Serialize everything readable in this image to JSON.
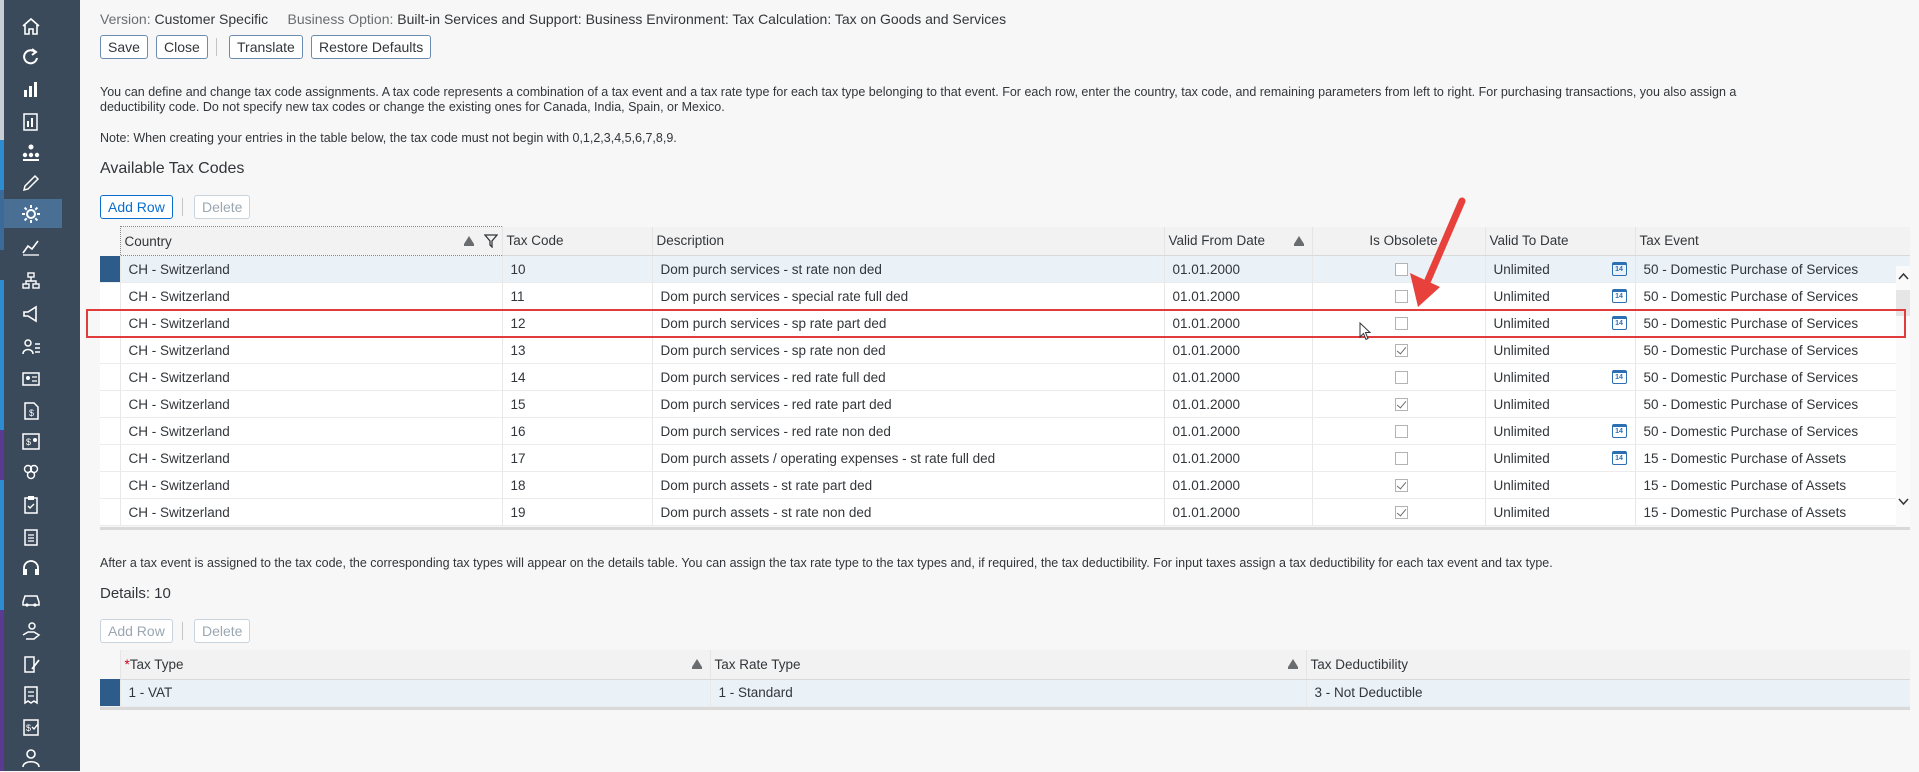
{
  "header": {
    "version_label": "Version:",
    "version_value": "Customer Specific",
    "bo_label": "Business Option:",
    "bo_value": "Built-in Services and Support: Business Environment: Tax Calculation: Tax on Goods and Services"
  },
  "toolbar": {
    "save": "Save",
    "close": "Close",
    "translate": "Translate",
    "restore": "Restore Defaults"
  },
  "intro": {
    "line1": "You can define and change tax code assignments. A tax code represents a combination of a tax event and a tax rate type for each tax type belonging to that event. For each row, enter the country, tax code, and remaining parameters from left to right. For purchasing transactions, you also assign a",
    "line2": "deductibility code. Do not specify new tax codes or change the existing ones for Canada, India, Spain, or Mexico.",
    "note": "Note: When creating your entries in the table below, the tax code must not begin with 0,1,2,3,4,5,6,7,8,9."
  },
  "tax_codes": {
    "title": "Available Tax Codes",
    "add_row": "Add Row",
    "delete": "Delete",
    "columns": [
      "Country",
      "Tax Code",
      "Description",
      "Valid From Date",
      "Is Obsolete",
      "Valid To Date",
      "Tax Event"
    ],
    "rows": [
      {
        "country": "CH - Switzerland",
        "code": "10",
        "desc": "Dom purch services - st rate non ded",
        "from": "01.01.2000",
        "obsolete": false,
        "to": "Unlimited",
        "cal": true,
        "event": "50 - Domestic Purchase of Services"
      },
      {
        "country": "CH - Switzerland",
        "code": "11",
        "desc": "Dom purch services - special rate full ded",
        "from": "01.01.2000",
        "obsolete": false,
        "to": "Unlimited",
        "cal": true,
        "event": "50 - Domestic Purchase of Services"
      },
      {
        "country": "CH - Switzerland",
        "code": "12",
        "desc": "Dom purch services - sp rate part ded",
        "from": "01.01.2000",
        "obsolete": false,
        "to": "Unlimited",
        "cal": true,
        "event": "50 - Domestic Purchase of Services"
      },
      {
        "country": "CH - Switzerland",
        "code": "13",
        "desc": "Dom purch services - sp rate non ded",
        "from": "01.01.2000",
        "obsolete": true,
        "to": "Unlimited",
        "cal": false,
        "event": "50 - Domestic Purchase of Services"
      },
      {
        "country": "CH - Switzerland",
        "code": "14",
        "desc": "Dom purch services - red rate full ded",
        "from": "01.01.2000",
        "obsolete": false,
        "to": "Unlimited",
        "cal": true,
        "event": "50 - Domestic Purchase of Services"
      },
      {
        "country": "CH - Switzerland",
        "code": "15",
        "desc": "Dom purch services - red rate part ded",
        "from": "01.01.2000",
        "obsolete": true,
        "to": "Unlimited",
        "cal": false,
        "event": "50 - Domestic Purchase of Services"
      },
      {
        "country": "CH - Switzerland",
        "code": "16",
        "desc": "Dom purch services - red rate non ded",
        "from": "01.01.2000",
        "obsolete": false,
        "to": "Unlimited",
        "cal": true,
        "event": "50 - Domestic Purchase of Services"
      },
      {
        "country": "CH - Switzerland",
        "code": "17",
        "desc": "Dom purch assets / operating expenses - st rate full ded",
        "from": "01.01.2000",
        "obsolete": false,
        "to": "Unlimited",
        "cal": true,
        "event": "15 - Domestic Purchase of Assets"
      },
      {
        "country": "CH - Switzerland",
        "code": "18",
        "desc": "Dom purch assets - st rate part ded",
        "from": "01.01.2000",
        "obsolete": true,
        "to": "Unlimited",
        "cal": false,
        "event": "15 - Domestic Purchase of Assets"
      },
      {
        "country": "CH - Switzerland",
        "code": "19",
        "desc": "Dom purch assets - st rate non ded",
        "from": "01.01.2000",
        "obsolete": true,
        "to": "Unlimited",
        "cal": false,
        "event": "15 - Domestic Purchase of Assets"
      }
    ]
  },
  "details_intro": "After a tax event is assigned to the tax code, the corresponding tax types will appear on the details table. You can assign the tax rate type to the tax types and, if required, the tax deductibility. For input taxes assign a tax deductibility for each tax event and tax type.",
  "details": {
    "title": "Details: 10",
    "add_row": "Add Row",
    "delete": "Delete",
    "required_mark": "*",
    "columns": [
      "Tax Type",
      "Tax Rate Type",
      "Tax Deductibility"
    ],
    "rows": [
      {
        "type": "1 - VAT",
        "rate": "1 - Standard",
        "deduct": "3 - Not Deductible"
      }
    ]
  },
  "calendar_glyph": "14",
  "colors": {
    "rail": "#3b4a5a",
    "selected_row_marker": "#2d5b8a",
    "highlight_box": "#e03c3c",
    "arrow": "#e8413c"
  },
  "icons": [
    "home-icon",
    "refresh-icon",
    "bar-chart-icon",
    "report-icon",
    "org-chart-icon",
    "edit-icon",
    "gear-icon",
    "analytics-icon",
    "hierarchy-icon",
    "megaphone-icon",
    "person-list-icon",
    "id-card-icon",
    "dollar-doc-icon",
    "dollar-id-icon",
    "cubes-icon",
    "clipboard-icon",
    "checklist-icon",
    "headset-icon",
    "car-icon",
    "hand-coin-icon",
    "pen-doc-icon",
    "receipt-icon",
    "dollar-check-icon",
    "person-icon"
  ]
}
